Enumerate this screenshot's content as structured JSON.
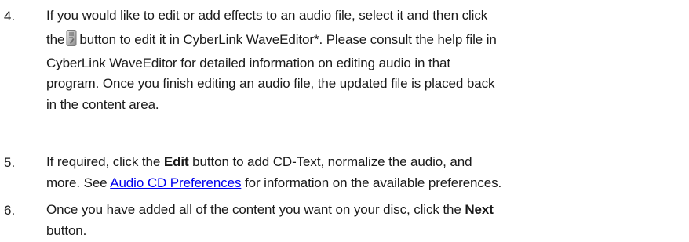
{
  "steps": [
    {
      "number": "4.",
      "line1": "If you would like to edit or add effects to an audio file, select it and then click",
      "line2_before_icon": "the",
      "line2_after_icon": "button to edit it in CyberLink WaveEditor*. Please consult the help file in",
      "line3": "CyberLink WaveEditor for detailed information on editing audio in that",
      "line4": "program. Once you finish editing an audio file, the updated file is placed back",
      "line5": "in the content area.",
      "icon": "wave-editor-icon"
    },
    {
      "number": "5.",
      "line1_before_bold": "If required, click the",
      "bold": "Edit",
      "line1_after_bold": "button to add CD-Text, normalize the audio, and",
      "line2_before_link": "more. See",
      "link": "Audio CD Preferences",
      "line2_after_link": "for information on the available preferences."
    },
    {
      "number": "6.",
      "line1_before_bold": "Once you have added all of the content you want on your disc, click the",
      "bold": "Next",
      "line2": "button."
    }
  ],
  "colors": {
    "text": "#1a1a1a",
    "link": "#0000ee"
  }
}
